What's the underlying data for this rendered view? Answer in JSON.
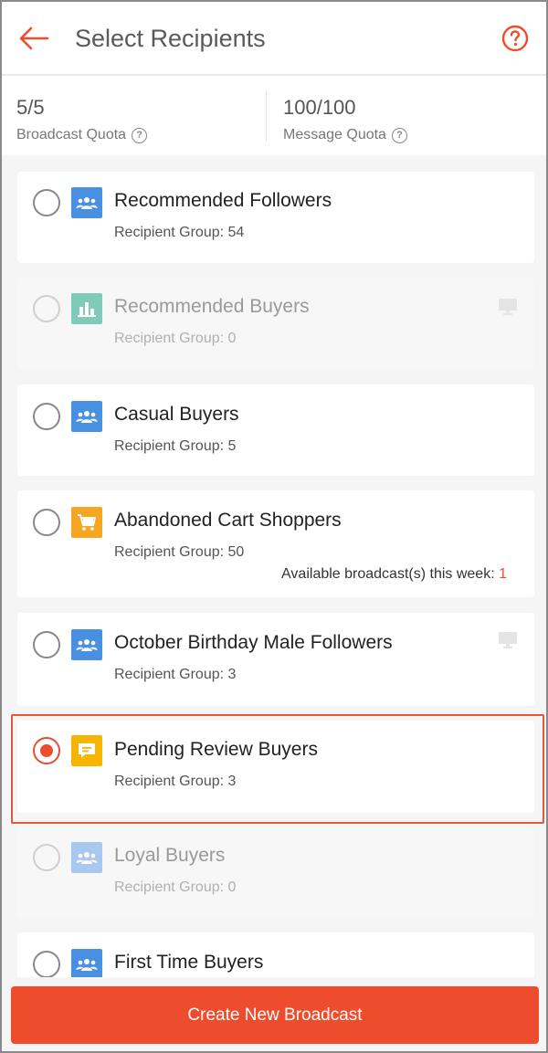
{
  "header": {
    "title": "Select Recipients",
    "back_icon": "arrow-left-icon",
    "help_icon": "question-circle-icon",
    "accent": "#ee4d2d"
  },
  "quota": {
    "broadcast": {
      "value": "5/5",
      "label": "Broadcast Quota"
    },
    "message": {
      "value": "100/100",
      "label": "Message Quota"
    }
  },
  "groups": [
    {
      "title": "Recommended Followers",
      "subtitle": "Recipient Group: 54",
      "icon": "users-icon",
      "icon_color": "#4a90e2",
      "disabled": false,
      "selected": false
    },
    {
      "title": "Recommended Buyers",
      "subtitle": "Recipient Group: 0",
      "icon": "bar-chart-icon",
      "icon_color": "#7fcab9",
      "disabled": true,
      "selected": false,
      "badge_icon": "monitor-icon"
    },
    {
      "title": "Casual Buyers",
      "subtitle": "Recipient Group: 5",
      "icon": "users-icon",
      "icon_color": "#4a90e2",
      "disabled": false,
      "selected": false
    },
    {
      "title": "Abandoned Cart Shoppers",
      "subtitle": "Recipient Group: 50",
      "icon": "cart-icon",
      "icon_color": "#f5a623",
      "disabled": false,
      "selected": false,
      "extra_label": "Available broadcast(s) this week:",
      "extra_value": "1"
    },
    {
      "title": "October Birthday Male Followers",
      "subtitle": "Recipient Group: 3",
      "icon": "users-icon",
      "icon_color": "#4a90e2",
      "disabled": false,
      "selected": false,
      "badge_icon": "monitor-icon"
    },
    {
      "title": "Pending Review Buyers",
      "subtitle": "Recipient Group: 3",
      "icon": "chat-icon",
      "icon_color": "#f7b500",
      "disabled": false,
      "selected": true
    },
    {
      "title": "Loyal Buyers",
      "subtitle": "Recipient Group: 0",
      "icon": "users-icon",
      "icon_color": "#a9c8f0",
      "disabled": true,
      "selected": false
    },
    {
      "title": "First Time Buyers",
      "subtitle": "",
      "icon": "users-icon",
      "icon_color": "#4a90e2",
      "disabled": false,
      "selected": false
    }
  ],
  "cta": {
    "label": "Create New Broadcast"
  }
}
